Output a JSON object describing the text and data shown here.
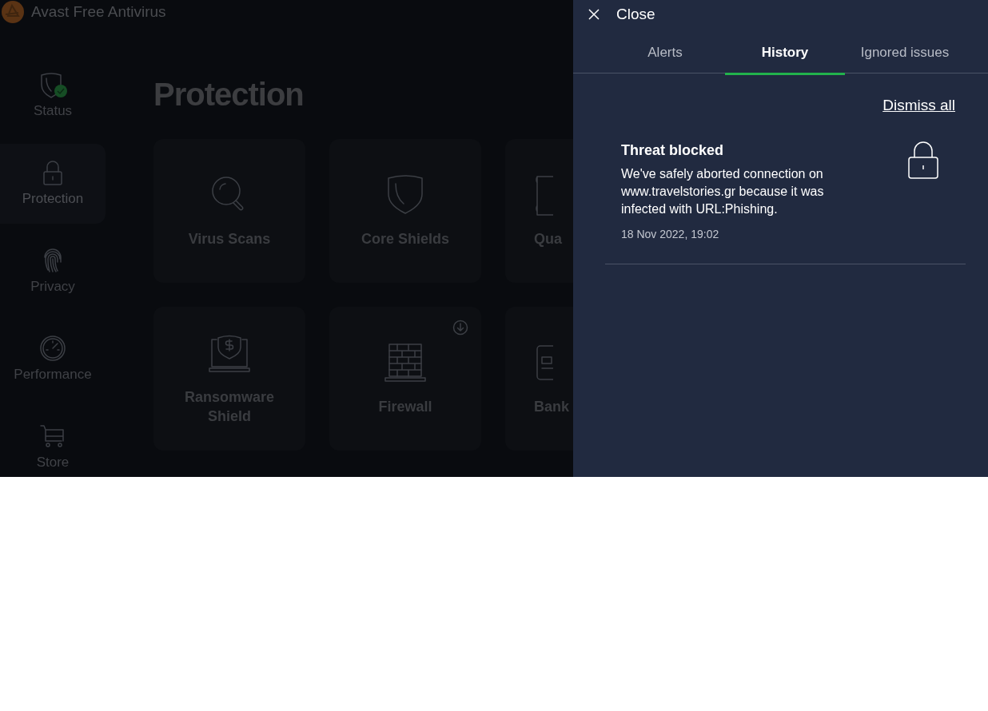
{
  "app": {
    "title": "Avast Free Antivirus"
  },
  "sidebar": {
    "items": [
      {
        "label": "Status",
        "selected": false
      },
      {
        "label": "Protection",
        "selected": true
      },
      {
        "label": "Privacy",
        "selected": false
      },
      {
        "label": "Performance",
        "selected": false
      },
      {
        "label": "Store",
        "selected": false
      }
    ]
  },
  "page": {
    "title": "Protection"
  },
  "cards": [
    {
      "label": "Virus Scans"
    },
    {
      "label": "Core Shields"
    },
    {
      "label": "Qua"
    },
    {
      "label": "Ransomware Shield"
    },
    {
      "label": "Firewall"
    },
    {
      "label": "Bank"
    }
  ],
  "panel": {
    "close": "Close",
    "tabs": [
      {
        "label": "Alerts",
        "selected": false
      },
      {
        "label": "History",
        "selected": true
      },
      {
        "label": "Ignored issues",
        "selected": false
      }
    ],
    "dismiss_all": "Dismiss all",
    "notifications": [
      {
        "title": "Threat blocked",
        "message": "We've safely aborted connection on www.travelstories.gr because it was infected with URL:Phishing.",
        "time": "18 Nov 2022, 19:02"
      }
    ]
  }
}
